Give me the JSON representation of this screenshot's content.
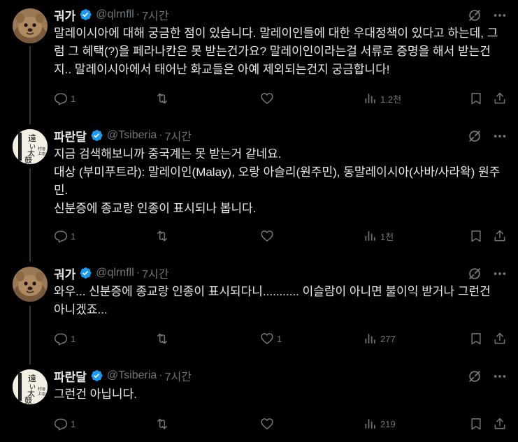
{
  "tweets": [
    {
      "name": "궈가",
      "handle": "@qlrnfll",
      "time": "7시간",
      "text": "말레이시아에 대해 궁금한 점이 있습니다. 말레이인들에 대한 우대정책이 있다고 하는데, 그럼 그 혜택(?)을 페라나칸은 못 받는건가요? 말레이인이라는걸 서류로 증명을 해서 받는건지.. 말레이시아에서 태어난 화교들은 아예 제외되는건지 궁금합니다!",
      "replies": "1",
      "retweets": "",
      "likes": "",
      "views": "1.2천"
    },
    {
      "name": "파란달",
      "handle": "@Tsiberia",
      "time": "7시간",
      "text": "지금 검색해보니까 중국계는 못 받는거 같네요.\n대상 (부미푸트라): 말레이인(Malay), 오랑 아슬리(원주민), 동말레이시아(사바/사라왁) 원주민.\n신분증에 종교랑 인종이 표시되나 봅니다.",
      "replies": "1",
      "retweets": "",
      "likes": "",
      "views": "1천"
    },
    {
      "name": "궈가",
      "handle": "@qlrnfll",
      "time": "7시간",
      "text": "와우... 신분증에 종교랑 인종이 표시되다니........... 이슬람이 아니면 불이익 받거나 그런건 아니겠죠...",
      "replies": "1",
      "retweets": "",
      "likes": "1",
      "views": "277"
    },
    {
      "name": "파란달",
      "handle": "@Tsiberia",
      "time": "7시간",
      "text": "그런건 아닙니다.",
      "replies": "1",
      "retweets": "",
      "likes": "",
      "views": "219"
    }
  ],
  "separator": "·",
  "avatar_text": {
    "tsiberia": [
      "遠",
      "い",
      "太",
      "鼓",
      "村",
      "上",
      "春",
      "樹"
    ]
  },
  "icons": {
    "verified": "verified-badge-icon",
    "grok": "grok-icon",
    "more": "more-icon",
    "reply": "reply-icon",
    "retweet": "retweet-icon",
    "like": "like-icon",
    "views": "views-icon",
    "bookmark": "bookmark-icon",
    "share": "share-icon"
  },
  "colors": {
    "background": "#000000",
    "text": "#e7e9ea",
    "secondary": "#71767b",
    "verified": "#1d9bf0",
    "thread_line": "#333639"
  }
}
